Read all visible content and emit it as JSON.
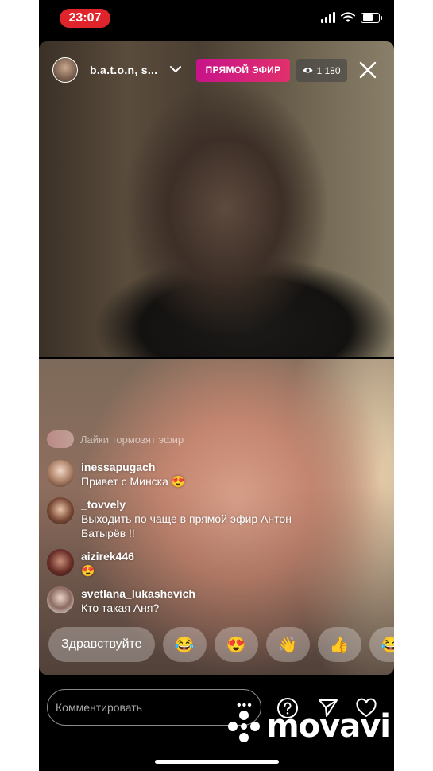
{
  "status_bar": {
    "time": "23:07"
  },
  "header": {
    "host_name": "b.a.t.o.n, s...",
    "live_label": "ПРЯМОЙ ЭФИР",
    "viewer_count": "1 180"
  },
  "comments": {
    "faded_text": "Лайки тормозят эфир",
    "items": [
      {
        "user": "inessapugach",
        "text": "Привет с Минска 😍"
      },
      {
        "user": "_tovvely",
        "text": "Выходить по чаще в прямой эфир Антон Батырёв !!"
      },
      {
        "user": "aizirek446",
        "text": "😍"
      },
      {
        "user": "svetlana_lukashevich",
        "text": "Кто такая Аня?"
      }
    ]
  },
  "reactions": {
    "greeting": "Здравствуйте",
    "emojis": [
      "😂",
      "😍",
      "👋",
      "👍",
      "😂"
    ]
  },
  "bottom_bar": {
    "comment_placeholder": "Комментировать",
    "more_label": "•••"
  },
  "watermark": {
    "text": "movavi"
  },
  "colors": {
    "status_time_bg": "#e0242c",
    "live_badge_start": "#c8138a",
    "live_badge_end": "#e1306c"
  }
}
